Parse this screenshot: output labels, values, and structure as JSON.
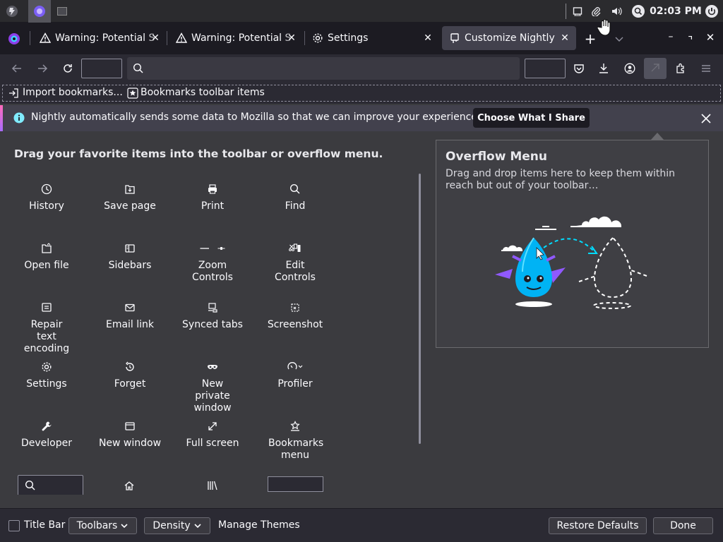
{
  "taskbar": {
    "clock": "02:03 PM"
  },
  "tabs": [
    {
      "label": "Warning: Potential S"
    },
    {
      "label": "Warning: Potential S"
    },
    {
      "label": "Settings"
    },
    {
      "label": "Customize Nightly"
    }
  ],
  "bookmarks": {
    "import": "Import bookmarks...",
    "toolbar_items": "Bookmarks toolbar items"
  },
  "notification": {
    "text": "Nightly automatically sends some data to Mozilla so that we can improve your experience.",
    "button": "Choose What I Share"
  },
  "palette": {
    "heading": "Drag your favorite items into the toolbar or overflow menu.",
    "items": [
      {
        "label": "History",
        "icon": "clock-icon"
      },
      {
        "label": "Save page",
        "icon": "save-icon"
      },
      {
        "label": "Print",
        "icon": "printer-icon"
      },
      {
        "label": "Find",
        "icon": "search-icon"
      },
      {
        "label": "Open file",
        "icon": "folder-icon"
      },
      {
        "label": "Sidebars",
        "icon": "sidebar-icon"
      },
      {
        "label": "Zoom Controls",
        "icon": "zoom-icon"
      },
      {
        "label": "Edit Controls",
        "icon": "edit-controls-icon"
      },
      {
        "label": "Repair text encoding",
        "icon": "encoding-icon"
      },
      {
        "label": "Email link",
        "icon": "mail-icon"
      },
      {
        "label": "Synced tabs",
        "icon": "synced-tabs-icon"
      },
      {
        "label": "Screenshot",
        "icon": "screenshot-icon"
      },
      {
        "label": "Settings",
        "icon": "gear-icon"
      },
      {
        "label": "Forget",
        "icon": "forget-icon"
      },
      {
        "label": "New private window",
        "icon": "mask-icon"
      },
      {
        "label": "Profiler",
        "icon": "profiler-icon"
      },
      {
        "label": "Developer",
        "icon": "wrench-icon"
      },
      {
        "label": "New window",
        "icon": "window-icon"
      },
      {
        "label": "Full screen",
        "icon": "fullscreen-icon"
      },
      {
        "label": "Bookmarks menu",
        "icon": "bookmarks-menu-icon"
      }
    ]
  },
  "overflow": {
    "title": "Overflow Menu",
    "description": "Drag and drop items here to keep them within reach but out of your toolbar…"
  },
  "footer": {
    "title_bar": "Title Bar",
    "toolbars": "Toolbars",
    "density": "Density",
    "manage_themes": "Manage Themes",
    "restore": "Restore Defaults",
    "done": "Done"
  },
  "colors": {
    "accent": "#00ddff",
    "notify_accent": "#ff6bba",
    "selected_tab": "#42414d"
  }
}
